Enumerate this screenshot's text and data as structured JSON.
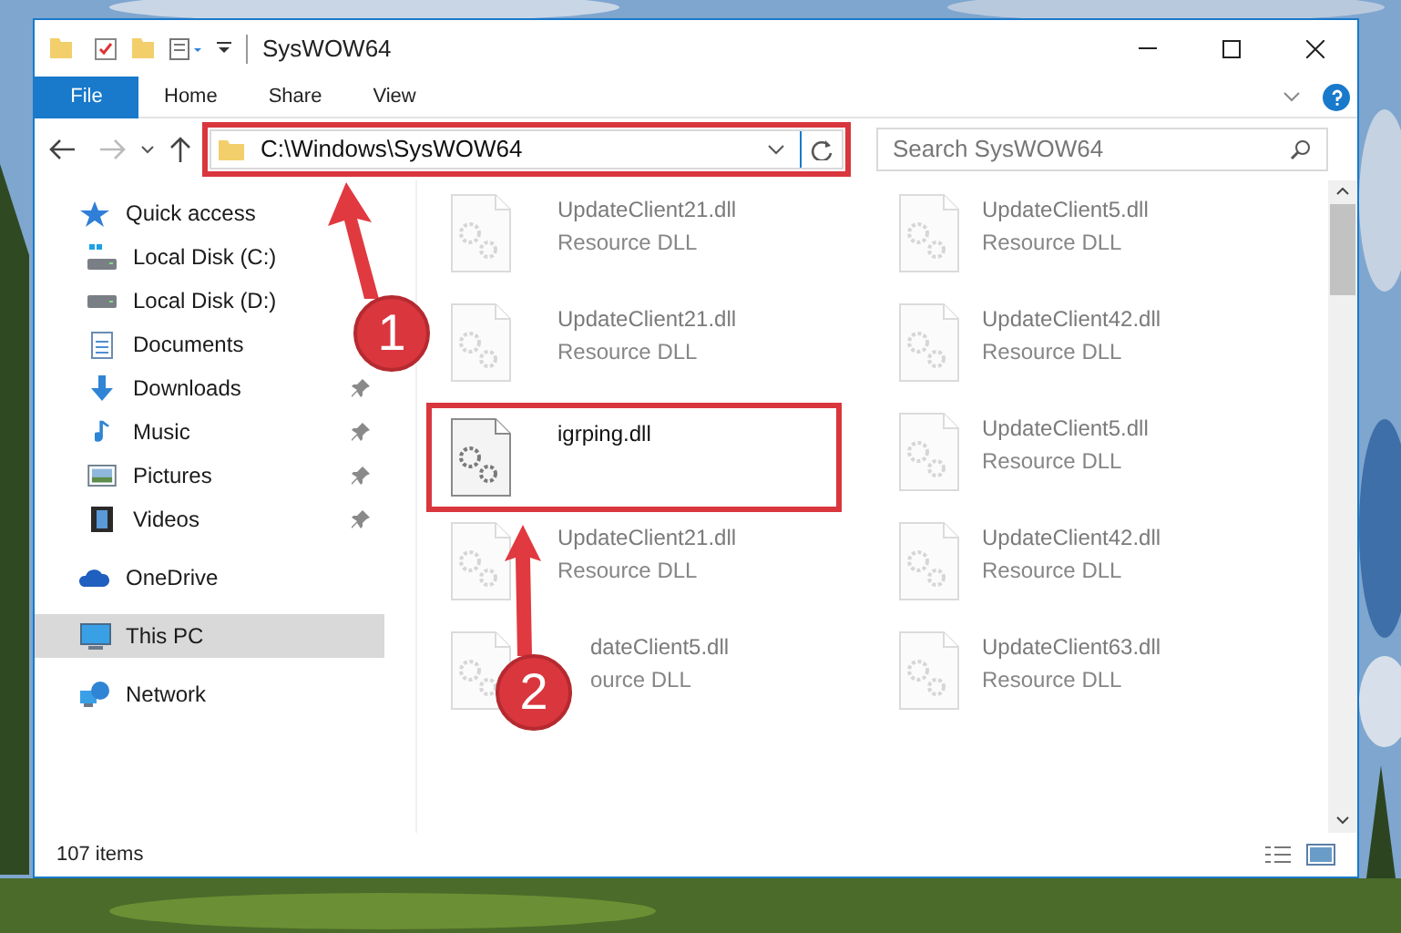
{
  "window": {
    "title": "SysWOW64"
  },
  "ribbon": {
    "tabs": [
      {
        "label": "File",
        "kind": "file",
        "selected": false
      },
      {
        "label": "Home",
        "kind": "tab",
        "selected": false
      },
      {
        "label": "Share",
        "kind": "tab",
        "selected": false
      },
      {
        "label": "View",
        "kind": "tab",
        "selected": false
      }
    ]
  },
  "address_bar": {
    "path": "C:\\Windows\\SysWOW64"
  },
  "search": {
    "placeholder": "Search SysWOW64"
  },
  "sidebar": {
    "items": [
      {
        "label": "Quick access",
        "kind": "star",
        "selected": false,
        "children": [
          {
            "label": "Local Disk (C:)",
            "kind": "system-drive",
            "pinned": false,
            "selected": false
          },
          {
            "label": "Local Disk (D:)",
            "kind": "drive",
            "pinned": false,
            "selected": false
          },
          {
            "label": "Documents",
            "kind": "documents",
            "pinned": false,
            "selected": false
          },
          {
            "label": "Downloads",
            "kind": "downloads",
            "pinned": true,
            "selected": false
          },
          {
            "label": "Music",
            "kind": "music",
            "pinned": true,
            "selected": false
          },
          {
            "label": "Pictures",
            "kind": "pictures",
            "pinned": true,
            "selected": false
          },
          {
            "label": "Videos",
            "kind": "videos",
            "pinned": true,
            "selected": false
          }
        ]
      },
      {
        "label": "OneDrive",
        "kind": "cloud",
        "selected": false
      },
      {
        "label": "This PC",
        "kind": "pc",
        "selected": true
      },
      {
        "label": "Network",
        "kind": "network",
        "selected": false
      }
    ]
  },
  "files": [
    {
      "name": "UpdateClient21.dll",
      "type": "Resource DLL",
      "kind": "dimmed"
    },
    {
      "name": "UpdateClient5.dll",
      "type": "Resource DLL",
      "kind": "dimmed"
    },
    {
      "name": "UpdateClient21.dll",
      "type": "Resource DLL",
      "kind": "dimmed"
    },
    {
      "name": "UpdateClient42.dll",
      "type": "Resource DLL",
      "kind": "dimmed"
    },
    {
      "name": "igrping.dll",
      "kind": "highlighted"
    },
    {
      "name": "UpdateClient5.dll",
      "type": "Resource DLL",
      "kind": "dimmed"
    },
    {
      "name": "UpdateClient21.dll",
      "type": "Resource DLL",
      "kind": "dimmed"
    },
    {
      "name": "UpdateClient42.dll",
      "type": "Resource DLL",
      "kind": "dimmed"
    },
    {
      "name": "dateClient5.dll",
      "type": "ource DLL",
      "kind": "covered"
    },
    {
      "name": "UpdateClient63.dll",
      "type": "Resource DLL",
      "kind": "dimmed"
    }
  ],
  "status_bar": {
    "count": "107 items"
  },
  "annotations": [
    {
      "number": "1"
    },
    {
      "number": "2"
    }
  ]
}
